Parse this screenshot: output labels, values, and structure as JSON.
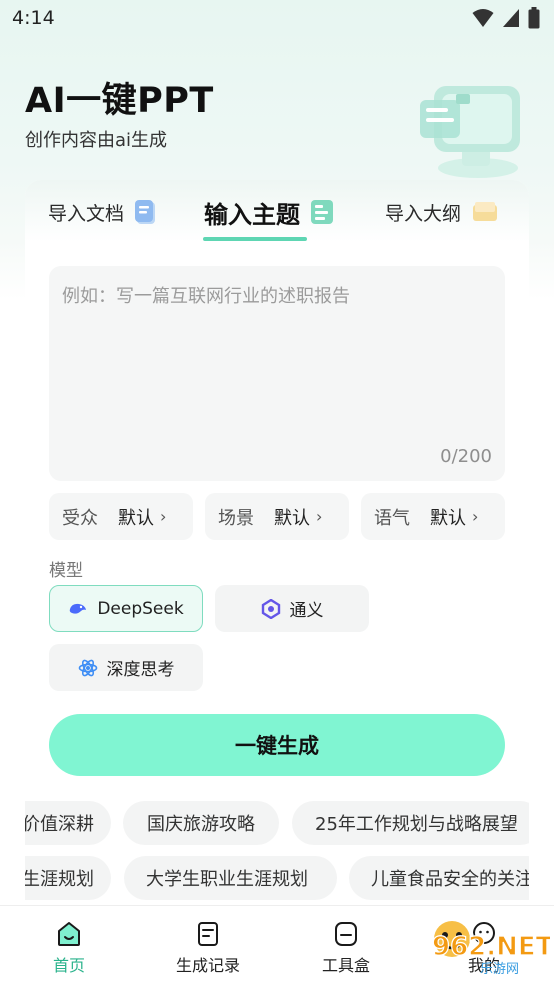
{
  "status": {
    "time": "4:14"
  },
  "hero": {
    "title": "AI一键PPT",
    "subtitle": "创作内容由ai生成"
  },
  "tabs": [
    {
      "label": "导入文档",
      "icon": "document-icon"
    },
    {
      "label": "输入主题",
      "icon": "topic-icon",
      "active": true
    },
    {
      "label": "导入大纲",
      "icon": "outline-icon"
    }
  ],
  "topic": {
    "placeholder": "例如：写一篇互联网行业的述职报告",
    "count": "0/200"
  },
  "options": [
    {
      "key": "受众",
      "value": "默认"
    },
    {
      "key": "场景",
      "value": "默认"
    },
    {
      "key": "语气",
      "value": "默认"
    }
  ],
  "model": {
    "label": "模型",
    "choices": [
      {
        "label": "DeepSeek",
        "icon": "deepseek-icon",
        "selected": true
      },
      {
        "label": "通义",
        "icon": "tongyi-icon"
      },
      {
        "label": "深度思考",
        "icon": "deep-think-icon"
      }
    ]
  },
  "generate_label": "一键生成",
  "suggestions_row1": [
    "价值深耕",
    "国庆旅游攻略",
    "25年工作规划与战略展望"
  ],
  "suggestions_row2": [
    "生涯规划",
    "大学生职业生涯规划",
    "儿童食品安全的关注"
  ],
  "nav": [
    {
      "label": "首页",
      "icon": "home-icon",
      "active": true
    },
    {
      "label": "生成记录",
      "icon": "records-icon"
    },
    {
      "label": "工具盒",
      "icon": "toolbox-icon"
    },
    {
      "label": "我的",
      "icon": "profile-icon"
    }
  ],
  "watermark": {
    "text": "962.NET",
    "subtext": "乐游网"
  },
  "colors": {
    "accent": "#80f5d2",
    "accent_border": "#7fdcbf",
    "active_text": "#2bb38c"
  }
}
